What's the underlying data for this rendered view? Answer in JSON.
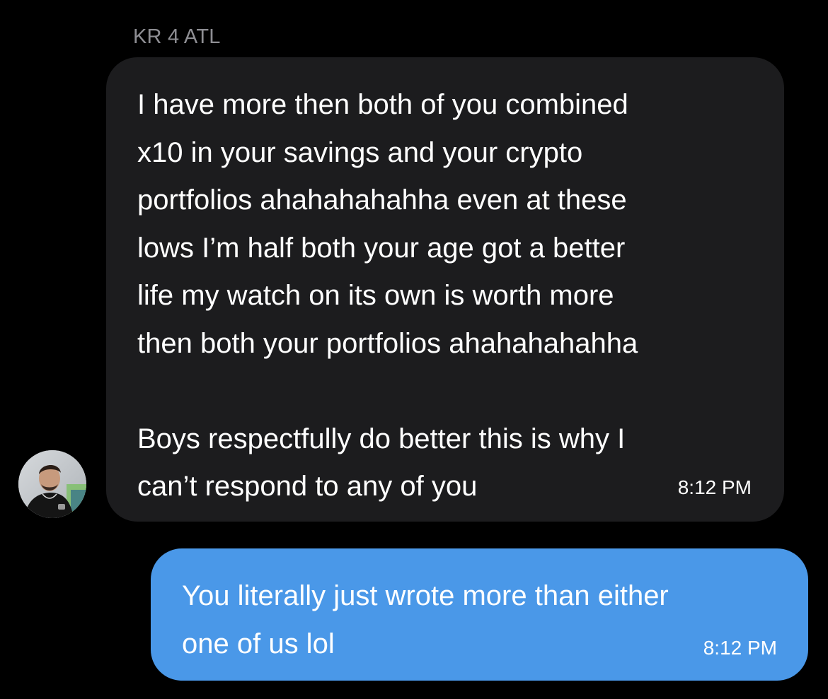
{
  "conversation": {
    "sender_name": "KR 4 ATL",
    "messages": [
      {
        "direction": "incoming",
        "text": "I have more then both of you combined\nx10 in your savings and your crypto\nportfolios ahahahahahha even at these\nlows I’m half both your age got a better\nlife my watch on its own is worth more\nthen both your portfolios ahahahahahha\n\nBoys respectfully do better this is why I\ncan’t respond to any of you",
        "time": "8:12 PM"
      },
      {
        "direction": "outgoing",
        "text": "You literally just wrote more than either\none of us lol",
        "time": "8:12 PM"
      }
    ]
  },
  "colors": {
    "background": "#000000",
    "incoming_bubble": "#1c1c1e",
    "outgoing_bubble": "#4a98e8",
    "sender_name": "#8e8e93",
    "text": "#ffffff"
  },
  "icons": {
    "avatar": "user-avatar-photo"
  }
}
